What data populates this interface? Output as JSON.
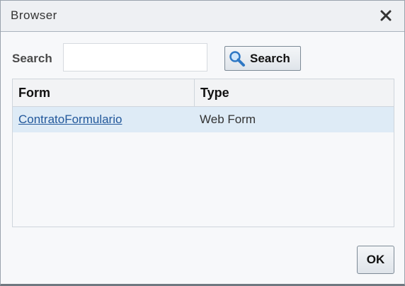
{
  "dialog": {
    "title": "Browser",
    "close_icon": "close-icon"
  },
  "search": {
    "label": "Search",
    "value": "",
    "placeholder": "",
    "button_label": "Search",
    "button_icon": "magnifier-icon"
  },
  "table": {
    "columns": [
      "Form",
      "Type"
    ],
    "rows": [
      {
        "form": "ContratoFormulario",
        "type": "Web Form"
      }
    ],
    "selected_row_color": "#deebf6",
    "link_color": "#22589b"
  },
  "footer": {
    "ok_label": "OK"
  }
}
